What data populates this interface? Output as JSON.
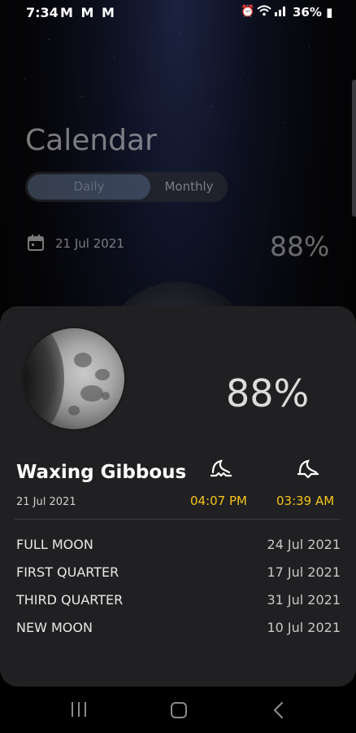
{
  "status_bar": {
    "time": "7:34",
    "notification_icons": "M M M",
    "battery": "36%"
  },
  "calendar": {
    "title": "Calendar",
    "tabs": {
      "daily": "Daily",
      "monthly": "Monthly",
      "selected": "Daily"
    },
    "date": "21 Jul 2021",
    "illumination": "88%"
  },
  "sheet": {
    "illumination": "88%",
    "phase_name": "Waxing Gibbous",
    "date": "21 Jul 2021",
    "moonrise_time": "04:07 PM",
    "moonset_time": "03:39 AM",
    "upcoming_phases": [
      {
        "label": "FULL MOON",
        "date": "24 Jul 2021"
      },
      {
        "label": "FIRST QUARTER",
        "date": "17 Jul 2021"
      },
      {
        "label": "THIRD QUARTER",
        "date": "31 Jul 2021"
      },
      {
        "label": "NEW MOON",
        "date": "10 Jul 2021"
      }
    ]
  },
  "colors": {
    "accent_time": "#f5c518",
    "sheet_bg": "#202022",
    "tab_selected": "#5d6e87"
  },
  "icons": [
    "alarm-icon",
    "wifi-icon",
    "signal-icon",
    "battery-icon",
    "calendar-icon",
    "moonrise-icon",
    "moonset-icon",
    "recent-apps-icon",
    "home-icon",
    "back-icon"
  ]
}
